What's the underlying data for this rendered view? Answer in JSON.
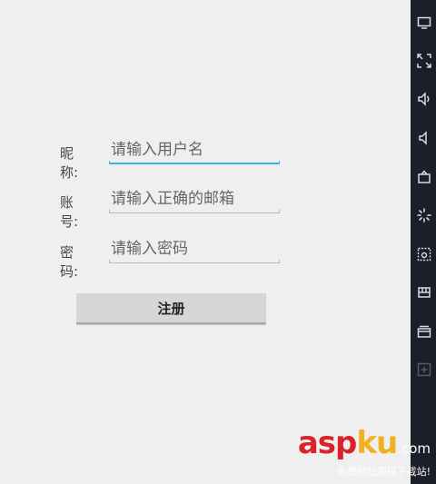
{
  "form": {
    "nickname": {
      "label": "昵称:",
      "placeholder": "请输入用户名",
      "value": ""
    },
    "account": {
      "label": "账号:",
      "placeholder": "请输入正确的邮箱",
      "value": ""
    },
    "password": {
      "label": "密码:",
      "placeholder": "请输入密码",
      "value": ""
    },
    "register_label": "注册"
  },
  "toolbar": {
    "icons": [
      "screen-icon",
      "fullscreen-icon",
      "volume-up-icon",
      "volume-down-icon",
      "rotate-icon",
      "loading-icon",
      "screenshot-icon",
      "device-icon",
      "settings-icon",
      "add-icon"
    ]
  },
  "watermark": {
    "brand_asp": "asp",
    "brand_ku": "ku",
    "tld": ".com",
    "tagline": "免费网站源码下载站!"
  },
  "colors": {
    "focus_accent": "#33b5e5",
    "background": "#efefef",
    "toolbar_bg": "#1c1f29",
    "button_bg": "#d6d6d6"
  }
}
